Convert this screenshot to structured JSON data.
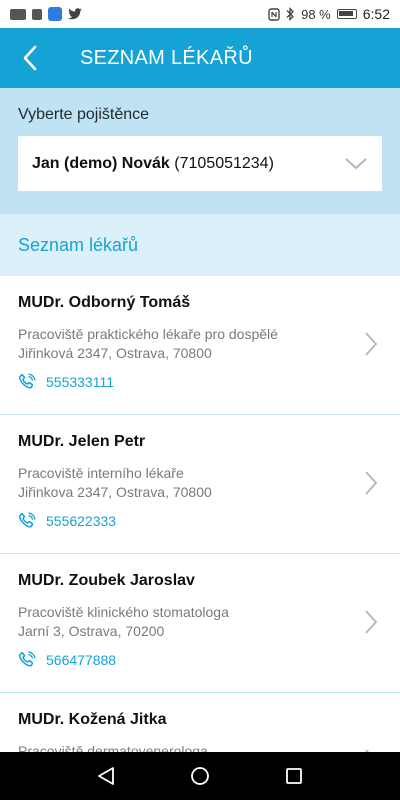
{
  "status_bar": {
    "icons_left": [
      "carrier-icon",
      "signal-4g-icon",
      "app-notification-icon",
      "twitter-icon"
    ],
    "battery_percent": "98 %",
    "time": "6:52"
  },
  "app_bar": {
    "title": "SEZNAM LÉKAŘŮ"
  },
  "selector": {
    "label": "Vyberte pojištěnce",
    "selected_name": "Jan (demo) Novák",
    "selected_id": "(7105051234)"
  },
  "section": {
    "title": "Seznam lékařů"
  },
  "doctors": [
    {
      "name": "MUDr. Odborný Tomáš",
      "workplace": "Pracoviště praktického lékaře pro dospělé",
      "address": "Jiřinková 2347, Ostrava, 70800",
      "phone": "555333111"
    },
    {
      "name": "MUDr. Jelen Petr",
      "workplace": "Pracoviště interního lékaře",
      "address": "Jiřinkova 2347, Ostrava, 70800",
      "phone": "555622333"
    },
    {
      "name": "MUDr. Zoubek Jaroslav",
      "workplace": "Pracoviště klinického stomatologa",
      "address": "Jarní 3, Ostrava, 70200",
      "phone": "566477888"
    },
    {
      "name": "MUDr. Kožená Jitka",
      "workplace": "Pracoviště dermatovenerologa",
      "address": "",
      "phone": ""
    }
  ],
  "colors": {
    "accent": "#15a3d6",
    "selector_bg": "#bfe3f3",
    "section_bg": "#dcf0f9"
  }
}
